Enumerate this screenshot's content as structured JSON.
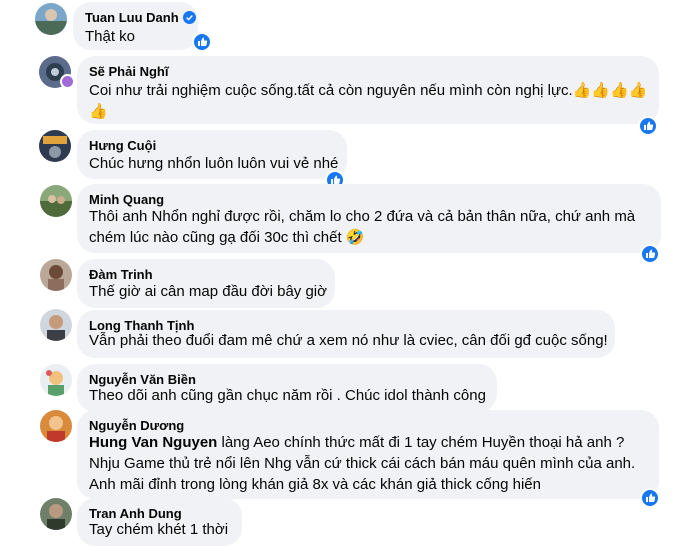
{
  "comments": [
    {
      "author": "Tuan Luu Danh",
      "lines": [
        "Thật ko"
      ]
    },
    {
      "author": "Sẽ Phải Nghĩ",
      "lines": [
        "Coi như trải nghiệm cuộc sống.tất cả còn nguyên nếu mình còn nghị lực.",
        ""
      ]
    },
    {
      "author": "Hưng Cuội",
      "lines": [
        "Chúc hưng nhổn luôn luôn vui vẻ nhé"
      ]
    },
    {
      "author": "Minh Quang",
      "lines": [
        "Thôi anh Nhổn nghỉ được rồi, chăm lo cho 2 đứa và cả bản thân nữa, chứ anh mà",
        "chém lúc nào cũng gạ đối 30c thì chết"
      ]
    },
    {
      "author": "Đàm Trinh",
      "lines": [
        "Thế giờ ai cân map đầu đời bây giờ"
      ]
    },
    {
      "author": "Long Thanh Tịnh",
      "lines": [
        "Vẫn phải theo đuổi đam mê chứ a xem nó như là cviec, cân đối gđ cuộc sống!"
      ]
    },
    {
      "author": "Nguyễn Văn Biền",
      "lines": [
        "Theo dõi anh cũng gần chục năm rồi . Chúc idol thành công"
      ]
    },
    {
      "author": "Nguyễn Dương",
      "mention": "Hung Van Nguyen",
      "lines": [
        " làng Aeo chính thức mất đi 1 tay chém Huyền thoại hả anh ?",
        "Nhju Game thủ trẻ nổi lên Nhg vẫn cứ thick cái cách bán máu quên mình của anh.",
        "Anh mãi đỉnh trong lòng khán giả 8x và các khán giả thick cống hiến"
      ]
    },
    {
      "author": "Tran Anh Dung",
      "lines": [
        "Tay chém khét 1 thời"
      ]
    }
  ],
  "colors": {
    "bubble": "#f0f2f5",
    "like": "#1877f2",
    "verified": "#1877f2",
    "status": "#a06bd8"
  },
  "icons": {
    "like": "thumbs-up-icon",
    "verified": "verified-badge-icon",
    "emoji_thumb": "thumbs-up-emoji",
    "emoji_laugh": "rolling-laughing-emoji"
  }
}
